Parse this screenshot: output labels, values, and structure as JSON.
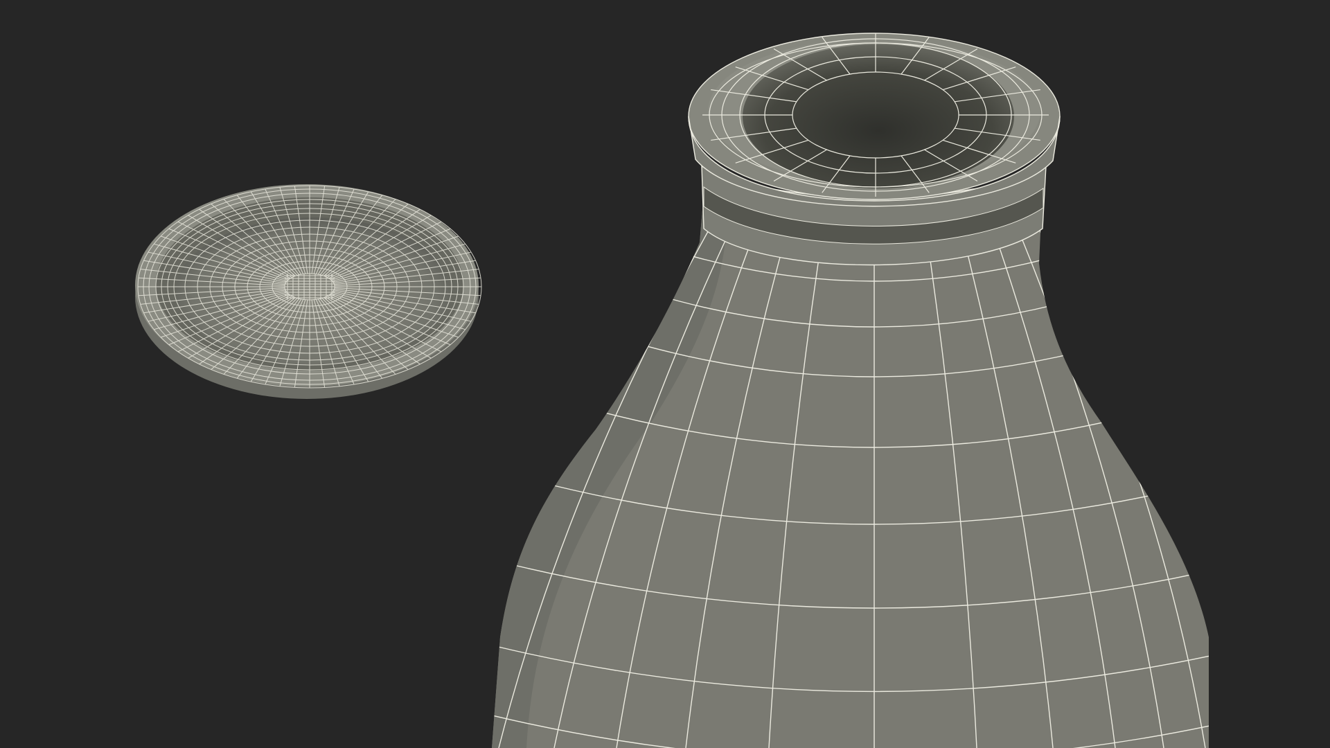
{
  "scene": {
    "description_visible_text": "",
    "colors": {
      "background": "#262626",
      "surface": "#7a7a72",
      "surface_shadow": "#5f605a",
      "surface_inner_dark": "#3a3b36",
      "wire": "#ecebe0"
    },
    "objects": [
      {
        "name": "bottle-cap",
        "kind": "wireframe-mesh"
      },
      {
        "name": "glass-bottle",
        "kind": "wireframe-mesh"
      }
    ]
  }
}
